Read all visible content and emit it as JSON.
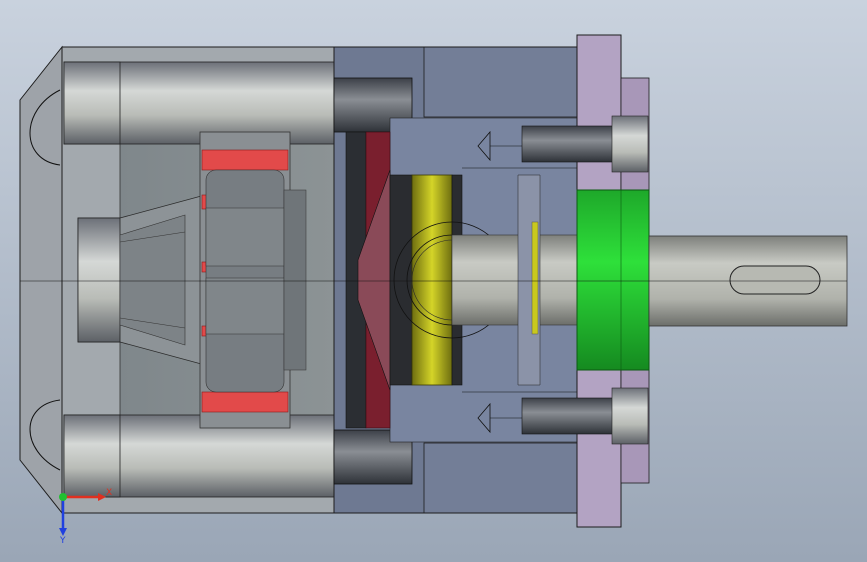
{
  "viewport": {
    "background_top": "#c9d2de",
    "background_bottom": "#9aa6b6"
  },
  "colors": {
    "housing": "#9fa6ad",
    "housing_dark": "#7c838b",
    "housing_edge": "#1c1c1c",
    "blue_plate": "#6f7a90",
    "flange": "#b4a4c2",
    "red_stripe": "#e04848",
    "maroon_seal": "#7a1f2e",
    "yellow_bearing": "#c8c81e",
    "green_hub": "#22d22e",
    "shaft": "#a9aba6"
  },
  "triad": {
    "x_label": "X",
    "y_label": "Y",
    "x_color": "#e03020",
    "y_color": "#2040e0",
    "origin_color": "#20c030"
  }
}
